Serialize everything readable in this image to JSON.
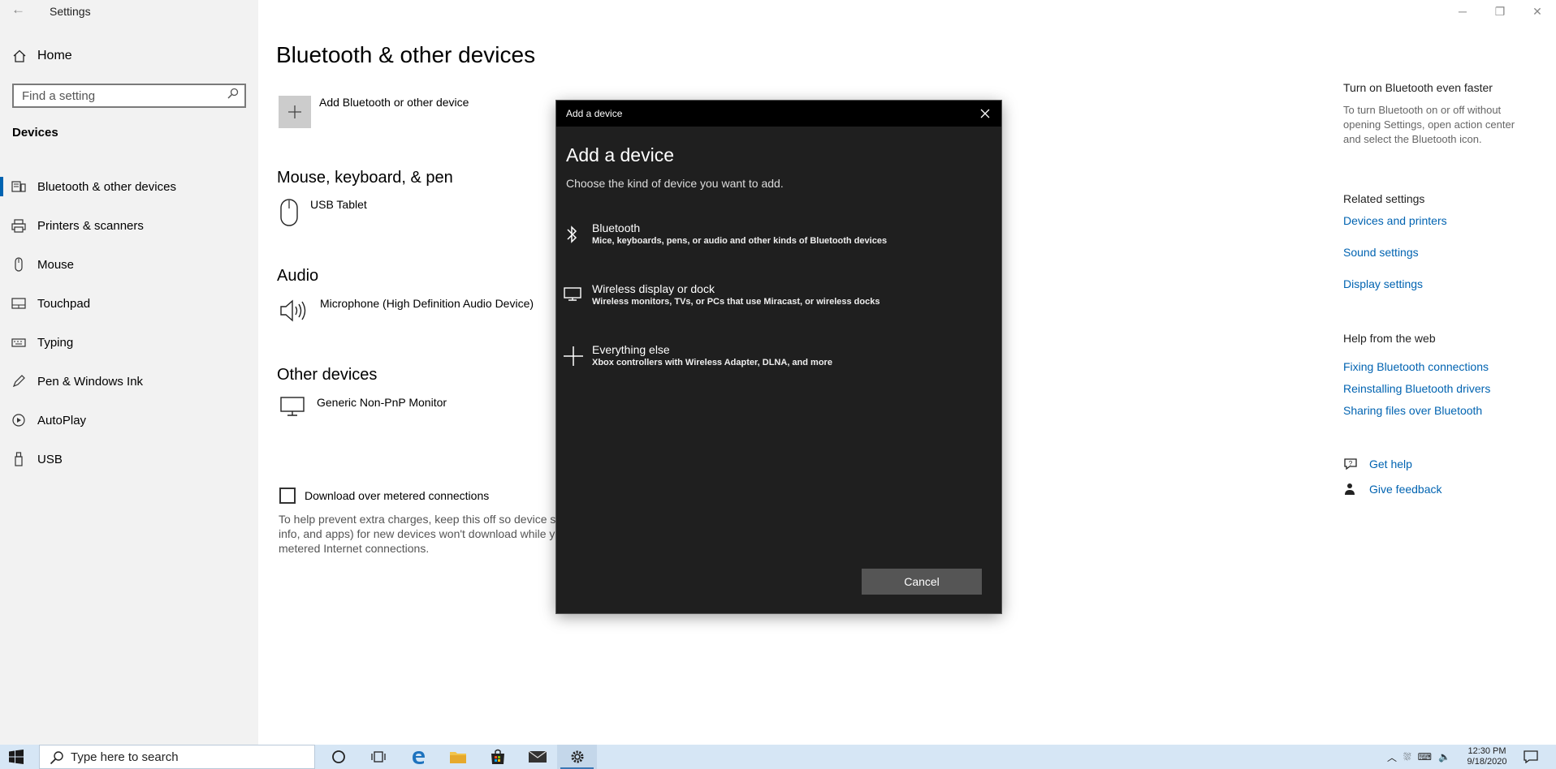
{
  "window": {
    "app_title": "Settings",
    "controls": [
      "minimize",
      "restore",
      "close"
    ]
  },
  "sidebar": {
    "home_label": "Home",
    "search_placeholder": "Find a setting",
    "section_title": "Devices",
    "items": [
      {
        "label": "Bluetooth & other devices",
        "icon": "bluetooth-devices-icon",
        "active": true
      },
      {
        "label": "Printers & scanners",
        "icon": "printer-icon",
        "active": false
      },
      {
        "label": "Mouse",
        "icon": "mouse-icon",
        "active": false
      },
      {
        "label": "Touchpad",
        "icon": "touchpad-icon",
        "active": false
      },
      {
        "label": "Typing",
        "icon": "keyboard-icon",
        "active": false
      },
      {
        "label": "Pen & Windows Ink",
        "icon": "pen-icon",
        "active": false
      },
      {
        "label": "AutoPlay",
        "icon": "autoplay-icon",
        "active": false
      },
      {
        "label": "USB",
        "icon": "usb-icon",
        "active": false
      }
    ]
  },
  "main": {
    "title": "Bluetooth & other devices",
    "add_device_label": "Add Bluetooth or other device",
    "groups": [
      {
        "title": "Mouse, keyboard, & pen",
        "devices": [
          {
            "name": "USB Tablet",
            "icon": "mouse-icon"
          }
        ]
      },
      {
        "title": "Audio",
        "devices": [
          {
            "name": "Microphone (High Definition Audio Device)",
            "icon": "speaker-icon"
          }
        ]
      },
      {
        "title": "Other devices",
        "devices": [
          {
            "name": "Generic Non-PnP Monitor",
            "icon": "monitor-icon"
          }
        ]
      }
    ],
    "metered_label": "Download over metered connections",
    "metered_checked": false,
    "metered_desc": "To help prevent extra charges, keep this off so device sc info, and apps) for new devices won't download while y metered Internet connections."
  },
  "right": {
    "faster_title": "Turn on Bluetooth even faster",
    "faster_desc": "To turn Bluetooth on or off without opening Settings, open action center and select the Bluetooth icon.",
    "related_title": "Related settings",
    "related_links": [
      "Devices and printers",
      "Sound settings",
      "Display settings"
    ],
    "help_title": "Help from the web",
    "help_links": [
      "Fixing Bluetooth connections",
      "Reinstalling Bluetooth drivers",
      "Sharing files over Bluetooth"
    ],
    "get_help": "Get help",
    "give_feedback": "Give feedback"
  },
  "dialog": {
    "bar_title": "Add a device",
    "title": "Add a device",
    "subtitle": "Choose the kind of device you want to add.",
    "options": [
      {
        "name": "Bluetooth",
        "desc": "Mice, keyboards, pens, or audio and other kinds of Bluetooth devices",
        "icon": "bluetooth-icon"
      },
      {
        "name": "Wireless display or dock",
        "desc": "Wireless monitors, TVs, or PCs that use Miracast, or wireless docks",
        "icon": "display-icon"
      },
      {
        "name": "Everything else",
        "desc": "Xbox controllers with Wireless Adapter, DLNA, and more",
        "icon": "plus-icon"
      }
    ],
    "cancel_label": "Cancel"
  },
  "taskbar": {
    "search_placeholder": "Type here to search",
    "apps": [
      "cortana-icon",
      "task-view-icon",
      "edge-icon",
      "file-explorer-icon",
      "store-icon",
      "mail-icon",
      "settings-icon"
    ],
    "time": "12:30 PM",
    "date": "9/18/2020"
  },
  "colors": {
    "accent": "#0063b1",
    "dialog_bg": "#1f1f1f",
    "taskbar_bg": "#d6e6f5",
    "sidebar_bg": "#f2f2f2"
  }
}
